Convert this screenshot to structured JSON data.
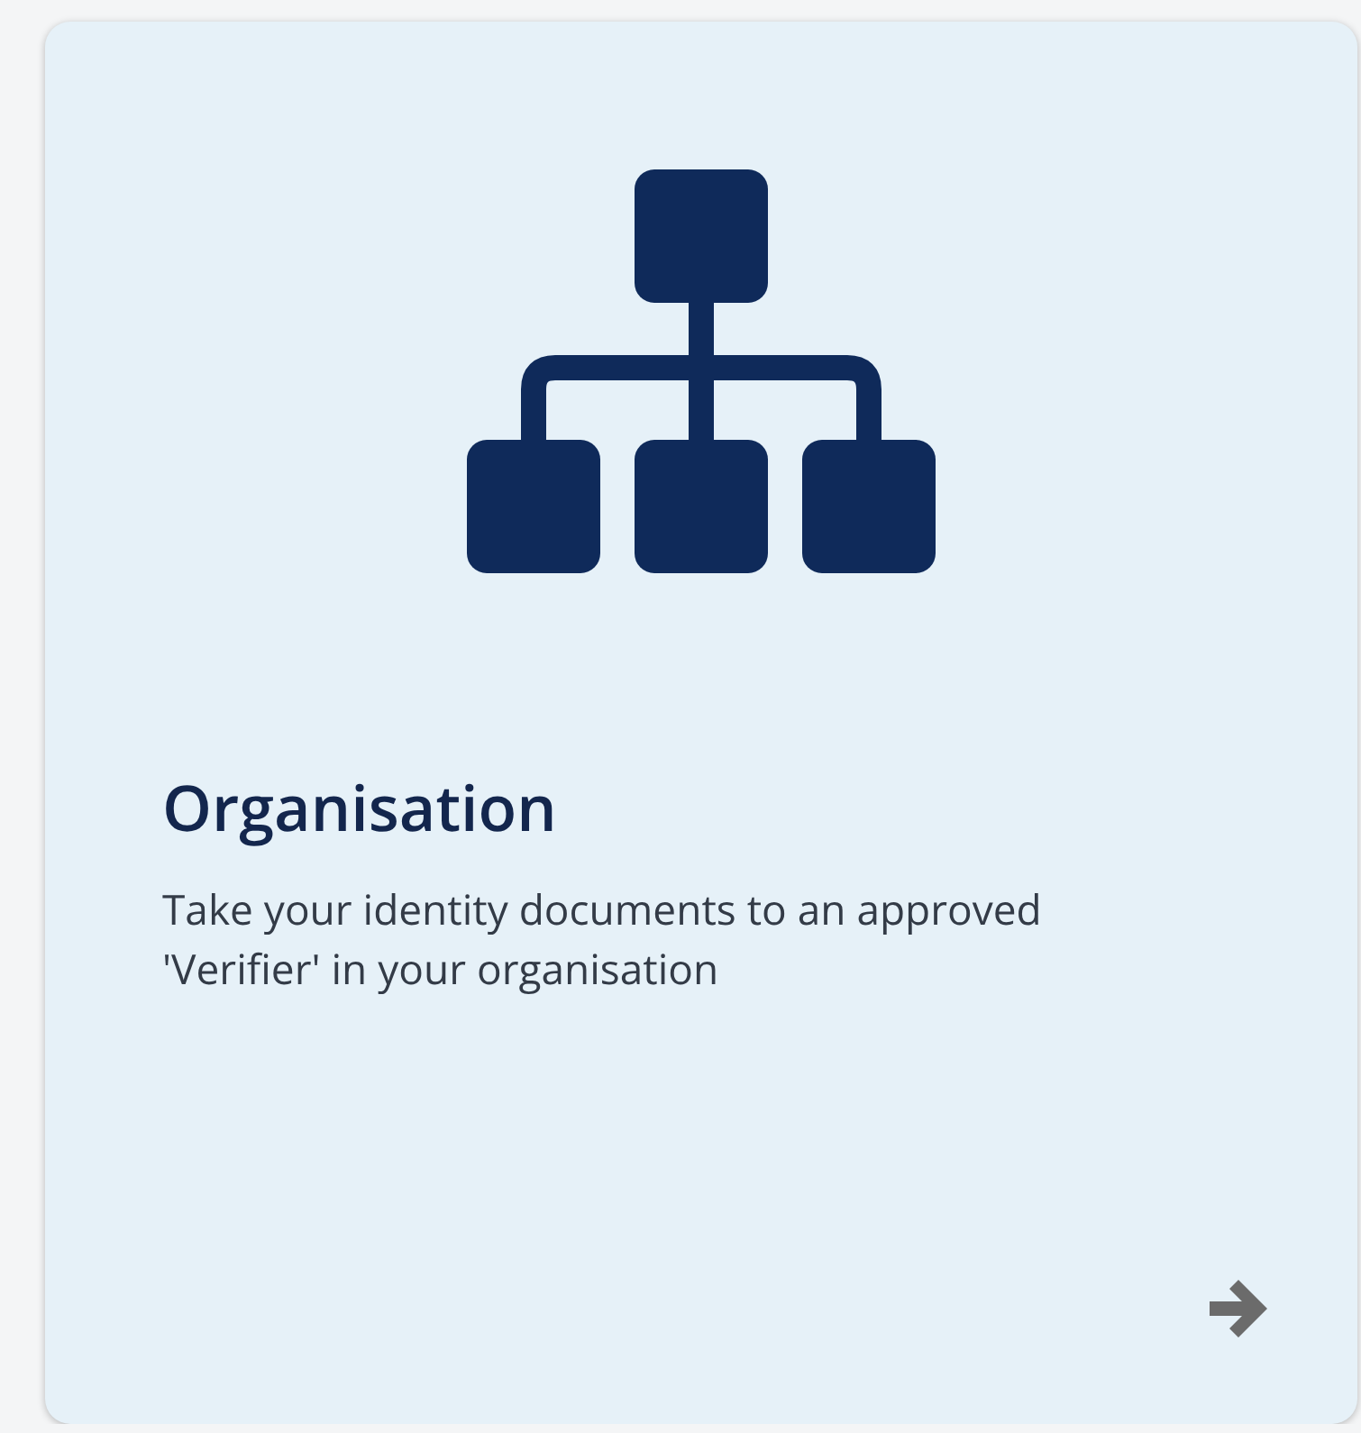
{
  "card": {
    "title": "Organisation",
    "description": "Take your identity documents to an approved 'Verifier' in your organisation"
  }
}
